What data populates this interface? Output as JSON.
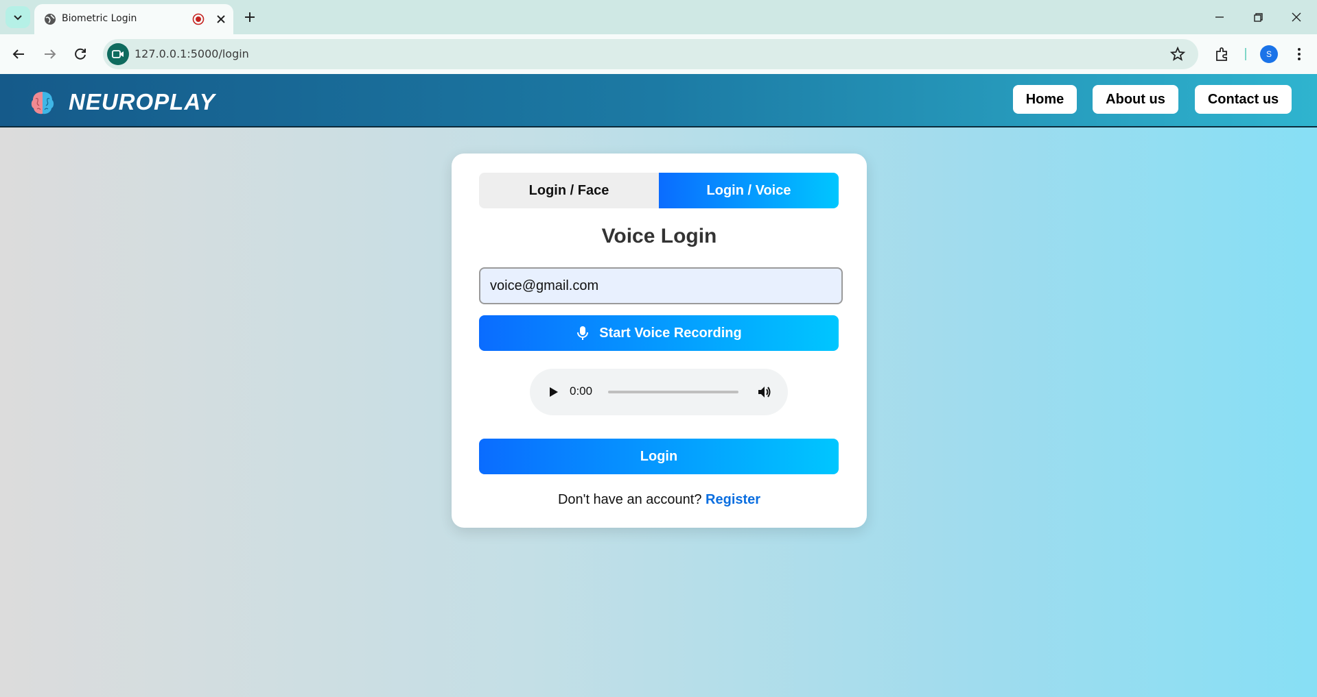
{
  "browser": {
    "tab_title": "Biometric Login",
    "url": "127.0.0.1:5000/login",
    "avatar_letter": "S"
  },
  "header": {
    "brand": "NEUROPLAY",
    "nav": [
      "Home",
      "About us",
      "Contact us"
    ]
  },
  "login": {
    "tabs": [
      "Login / Face",
      "Login / Voice"
    ],
    "active_tab": "Login / Voice",
    "title": "Voice Login",
    "email_value": "voice@gmail.com",
    "record_label": "Start Voice Recording",
    "audio_time": "0:00",
    "login_label": "Login",
    "register_prompt": "Don't have an account?",
    "register_link": "Register"
  },
  "colors": {
    "accent_start": "#0a6cff",
    "accent_end": "#00c6ff",
    "header_start": "#155a8a",
    "header_end": "#2fb4cf",
    "link": "#0a6ee0"
  },
  "icons": [
    "tab-search-icon",
    "globe-icon",
    "recording-icon",
    "close-icon",
    "new-tab-icon",
    "minimize-icon",
    "restore-icon",
    "back-icon",
    "forward-icon",
    "reload-icon",
    "site-info-icon",
    "star-icon",
    "extensions-icon",
    "menu-icon",
    "brain-logo-icon",
    "mic-icon",
    "play-icon",
    "volume-icon"
  ]
}
